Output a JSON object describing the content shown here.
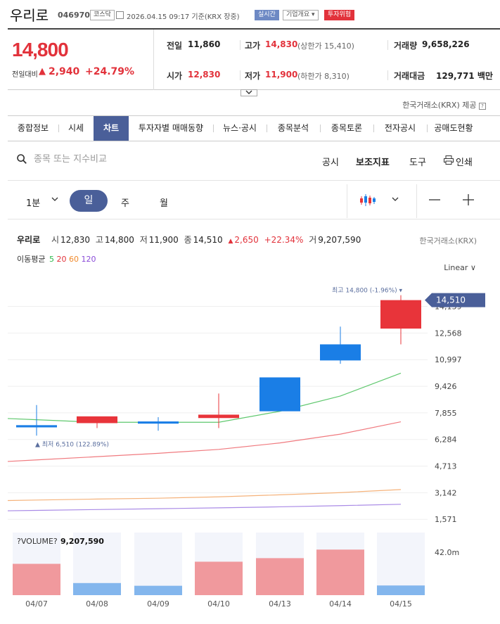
{
  "header": {
    "name": "우리로",
    "code": "046970",
    "market": "코스닥",
    "datetime": "2026.04.15 09:17 기준(KRX 장중)",
    "realtime": "실시간",
    "profile": "기업개요 ▾",
    "risk": "투자위험"
  },
  "price": {
    "current": "14,800",
    "change_label": "전일대비",
    "change_arrow": "▲",
    "change": "2,940",
    "change_pct": "+24.79%",
    "prev_label": "전일",
    "prev": "11,860",
    "high_label": "고가",
    "high": "14,830",
    "upper_limit": "(상한가 15,410)",
    "volume_label": "거래량",
    "volume": "9,658,226",
    "open_label": "시가",
    "open": "12,830",
    "low_label": "저가",
    "low": "11,900",
    "lower_limit": "(하한가 8,310)",
    "amount_label": "거래대금",
    "amount": "129,771 백만",
    "toggle_icon": "chevron-down-icon"
  },
  "provider": "한국거래소(KRX) 제공",
  "tabs": [
    "종합정보",
    "시세",
    "차트",
    "투자자별 매매동향",
    "뉴스·공시",
    "종목분석",
    "종목토론",
    "전자공시",
    "공매도현황"
  ],
  "active_tab": "차트",
  "search": {
    "placeholder": "종목 또는 지수비교"
  },
  "tools": {
    "disclosure": "공시",
    "indicator": "보조지표",
    "tool": "도구",
    "print": "인쇄"
  },
  "period": {
    "minute": "1분",
    "day": "일",
    "week": "주",
    "month": "월"
  },
  "chart_info": {
    "name": "우리로",
    "open_label": "시",
    "open": "12,830",
    "high_label": "고",
    "high": "14,800",
    "low_label": "저",
    "low": "11,900",
    "close_label": "종",
    "close": "14,510",
    "arrow": "▲",
    "change": "2,650",
    "pct": "+22.34%",
    "vol_label": "거",
    "vol": "9,207,590",
    "ma_label": "이동평균",
    "ma": [
      {
        "period": "5",
        "color": "#2db84d"
      },
      {
        "period": "20",
        "color": "#e2323b"
      },
      {
        "period": "60",
        "color": "#f08a2c"
      },
      {
        "period": "120",
        "color": "#8a4bd8"
      }
    ],
    "exchange": "한국거래소(KRX)",
    "scale": "Linear ∨"
  },
  "chart_data": {
    "type": "candlestick",
    "dates": [
      "04/07",
      "04/08",
      "04/09",
      "04/10",
      "04/13",
      "04/14",
      "04/15"
    ],
    "open": [
      7130,
      7250,
      7350,
      7550,
      9950,
      11900,
      12830
    ],
    "high": [
      8320,
      7580,
      7600,
      9000,
      9950,
      12950,
      14800
    ],
    "low": [
      6510,
      6960,
      6800,
      6960,
      7950,
      10750,
      11900
    ],
    "close": [
      7000,
      7650,
      7220,
      7750,
      7950,
      10950,
      14510
    ],
    "ma5": [
      7450,
      7300,
      7300,
      7300,
      7950,
      8850,
      10200
    ],
    "ma20": [
      5080,
      5270,
      5470,
      5700,
      6080,
      6600,
      7330
    ],
    "ma60": [
      2710,
      2770,
      2820,
      2900,
      3020,
      3150,
      3330
    ],
    "ma120": [
      2100,
      2150,
      2200,
      2250,
      2310,
      2380,
      2460
    ],
    "yticks": [
      "1,571",
      "3,142",
      "4,713",
      "6,284",
      "7,855",
      "9,426",
      "10,997",
      "12,568",
      "14,139"
    ],
    "y_range": [
      1000,
      15200
    ],
    "current_label": "14,510",
    "max_label": "최고 14,800 (-1.96%) ▾",
    "min_label": "▲ 최저 6,510 (122.89%)",
    "volume": {
      "label": "?VOLUME?",
      "value": "9,207,590",
      "axis_label": "42.0m",
      "max": 42000000,
      "values": [
        22000000,
        8500000,
        6600000,
        23500000,
        26000000,
        32000000,
        6800000
      ],
      "direction": [
        "up",
        "down",
        "down",
        "up",
        "up",
        "up",
        "down"
      ]
    }
  },
  "colors": {
    "up": "#e8343a",
    "down": "#1a7ee6",
    "accent": "#4a5f99",
    "vol_up": "#f0999d",
    "vol_down": "#83b6ed"
  }
}
